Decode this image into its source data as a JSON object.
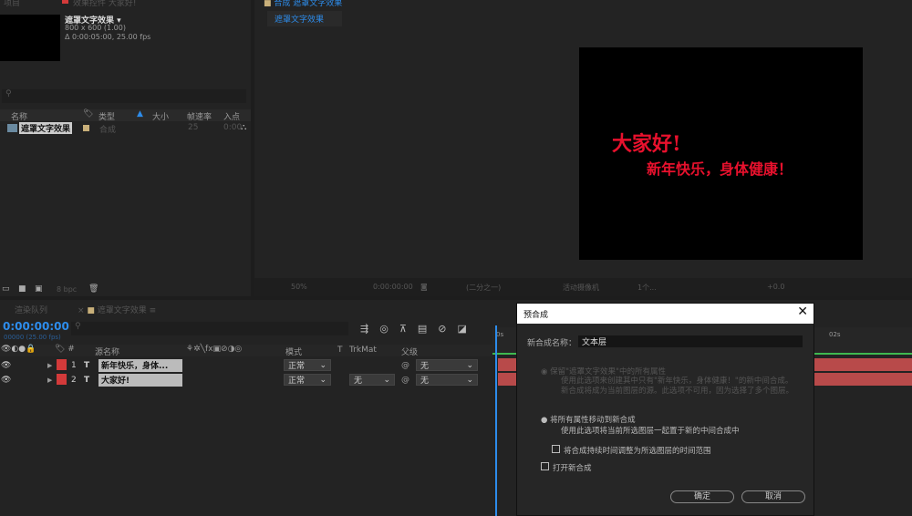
{
  "project": {
    "tab_label": "项目",
    "effects_tab": "效果控件 大家好!",
    "comp_name": "遮罩文字效果",
    "comp_size": "800 x 600 (1.00)",
    "comp_duration": "Δ 0:00:05:00, 25.00 fps",
    "columns": [
      "名称",
      "类型",
      "大小",
      "帧速率",
      "入点"
    ],
    "items": [
      {
        "name": "遮罩文字效果",
        "type": "合成",
        "fps": "25",
        "in": "0:00"
      }
    ],
    "bpc": "8 bpc"
  },
  "viewer": {
    "tab_label": "合成 遮罩文字效果",
    "comp_tab": "遮罩文字效果",
    "line1": "大家好!",
    "line2": "新年快乐，身体健康！",
    "toolbar": {
      "zoom": "50%",
      "time": "0:00:00:00",
      "resolution": "(二分之一)",
      "camera": "活动摄像机",
      "views": "1个...",
      "exposure": "+0.0"
    }
  },
  "timeline": {
    "tabs": [
      "渲染队列",
      "遮罩文字效果"
    ],
    "timecode": "0:00:00:00",
    "frame_info": "00000 (25.00 fps)",
    "columns": {
      "source": "源名称",
      "mode": "模式",
      "t": "T",
      "trkmat": "TrkMat",
      "parent": "父级"
    },
    "ruler": [
      "0s",
      "02s"
    ],
    "layers": [
      {
        "num": "1",
        "type": "T",
        "name": "新年快乐，身体...",
        "mode": "正常",
        "trkmat": "",
        "parent": "无"
      },
      {
        "num": "2",
        "type": "T",
        "name": "大家好!",
        "mode": "正常",
        "trkmat": "无",
        "parent": "无"
      }
    ]
  },
  "dialog": {
    "title": "预合成",
    "name_label": "新合成名称：",
    "name_value": "文本层",
    "option1_title": "保留\"遮罩文字效果\"中的所有属性",
    "option1_desc": "使用此选项来创建其中只有\"新年快乐，身体健康！\"的新中间合成。新合成将成为当前图层的源。此选项不可用，因为选择了多个图层。",
    "option2_title": "将所有属性移动到新合成",
    "option2_desc": "使用此选项将当前所选图层一起置于新的中间合成中",
    "adjust_label": "将合成持续时间调整为所选图层的时间范围",
    "open_label": "打开新合成",
    "ok": "确定",
    "cancel": "取消"
  },
  "colors": {
    "accent": "#2d8ceb",
    "label_red": "#d33a3a",
    "text_red": "#e8112d",
    "green": "#3fb950"
  }
}
